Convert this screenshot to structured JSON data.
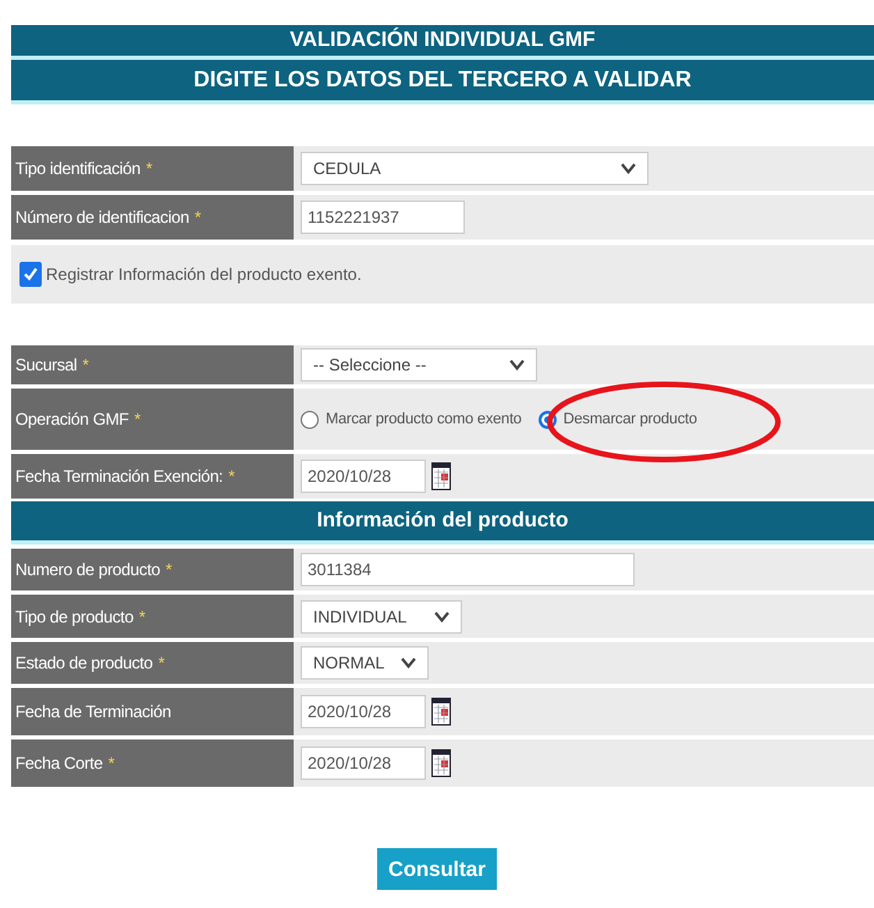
{
  "title": "VALIDACIÓN INDIVIDUAL GMF",
  "subtitle": "DIGITE LOS DATOS DEL TERCERO A VALIDAR",
  "identification_rows": [
    {
      "kind": "select",
      "label": "Tipo identificación",
      "marker": "*",
      "value": "CEDULA"
    },
    {
      "kind": "text",
      "label": "Número de identificacion",
      "marker": "*",
      "value": "1152221937"
    }
  ],
  "exento_checkbox": {
    "label": "Registrar Información del producto exento.",
    "checked": true
  },
  "exencion_rows": [
    {
      "kind": "select",
      "label": "Sucursal",
      "marker": "*",
      "value": "-- Seleccione --"
    },
    {
      "kind": "radio",
      "label": "Operación GMF",
      "marker": "*",
      "options": [
        {
          "label": "Marcar producto como exento",
          "selected": false
        },
        {
          "label": "Desmarcar producto",
          "selected": true
        }
      ]
    },
    {
      "kind": "date",
      "label": "Fecha Terminación Exención:",
      "marker": "*",
      "value": "2020/10/28"
    }
  ],
  "product_section": {
    "title": "Información del producto",
    "rows": [
      {
        "kind": "text",
        "label": "Numero de producto",
        "marker": "*",
        "value": "3011384"
      },
      {
        "kind": "select",
        "label": "Tipo de producto",
        "marker": "*",
        "value": "INDIVIDUAL"
      },
      {
        "kind": "select",
        "label": "Estado de producto",
        "marker": "*",
        "value": "NORMAL"
      },
      {
        "kind": "date",
        "label": "Fecha de Terminación",
        "value": "2020/10/28"
      },
      {
        "kind": "date",
        "label": "Fecha Corte",
        "marker": "*",
        "value": "2020/10/28"
      }
    ]
  },
  "annotation": {
    "kind": "ellipse"
  },
  "button": "Consultar"
}
